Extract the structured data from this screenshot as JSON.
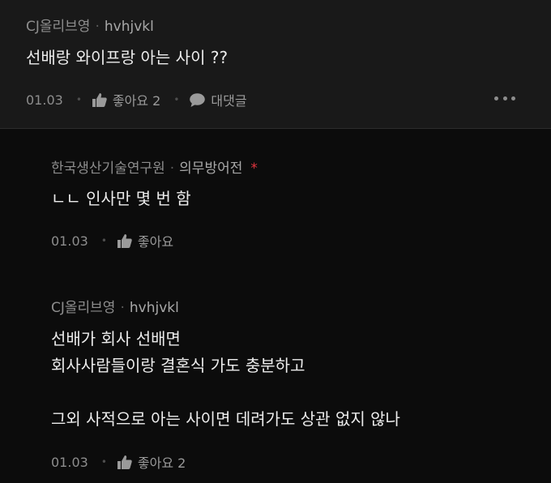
{
  "comment": {
    "author": "CJ올리브영",
    "nickname": "hvhjvkl",
    "separator": "·",
    "text": "선배랑 와이프랑 아는 사이 ??",
    "date": "01.03",
    "like_label": "좋아요 2",
    "reply_label": "대댓글",
    "icons": [
      "thumbs-up-icon",
      "speech-bubble-icon",
      "more-icon"
    ]
  },
  "replies": [
    {
      "author": "한국생산기술연구원",
      "nickname": "의무방어전",
      "author_marker": "*",
      "text": "ㄴㄴ 인사만 몇 번 함",
      "date": "01.03",
      "like_label": "좋아요"
    },
    {
      "author": "CJ올리브영",
      "nickname": "hvhjvkl",
      "text_lines": [
        "선배가 회사 선배면",
        "회사사람들이랑 결혼식 가도 충분하고",
        "",
        "그외 사적으로 아는 사이면 데려가도 상관 없지 않나"
      ],
      "date": "01.03",
      "like_label": "좋아요 2"
    }
  ],
  "colors": {
    "background": "#0c0c0c",
    "main_comment_bg": "#191919",
    "accent_red": "#e0343e"
  }
}
